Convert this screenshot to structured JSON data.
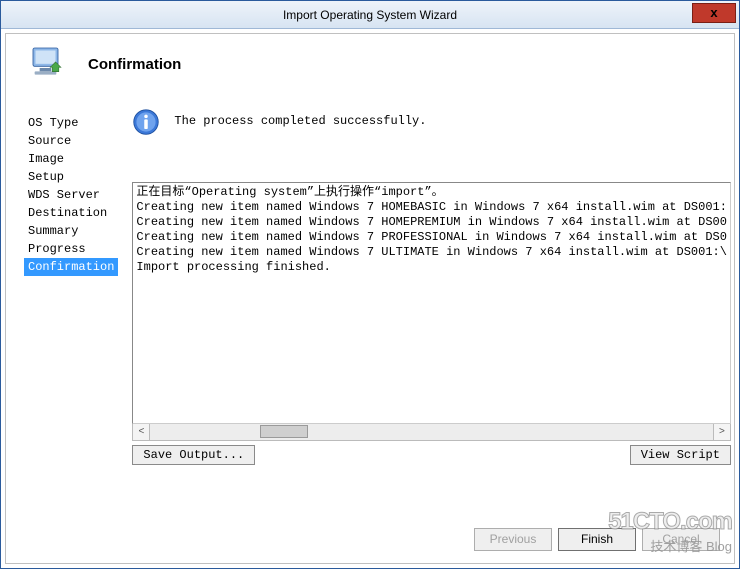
{
  "titlebar": {
    "title": "Import Operating System Wizard",
    "close": "x"
  },
  "header": {
    "title": "Confirmation"
  },
  "sidebar": {
    "items": [
      "OS Type",
      "Source",
      "Image",
      "Setup",
      "WDS Server",
      "Destination",
      "Summary",
      "Progress",
      "Confirmation"
    ],
    "selected_index": 8
  },
  "status": {
    "message": "The process completed successfully."
  },
  "output": {
    "lines": [
      "正在目标“Operating system”上执行操作“import”。",
      "Creating new item named Windows 7 HOMEBASIC in Windows 7 x64 install.wim at DS001:",
      "Creating new item named Windows 7 HOMEPREMIUM in Windows 7 x64 install.wim at DS00",
      "Creating new item named Windows 7 PROFESSIONAL in Windows 7 x64 install.wim at DS0",
      "Creating new item named Windows 7 ULTIMATE in Windows 7 x64 install.wim at DS001:\\",
      "Import processing finished."
    ]
  },
  "buttons": {
    "save_output": "Save Output...",
    "view_script": "View Script",
    "previous": "Previous",
    "finish": "Finish",
    "cancel": "Cancel"
  },
  "watermark": {
    "line1": "51CTO.com",
    "line2": "技术博客 Blog"
  }
}
